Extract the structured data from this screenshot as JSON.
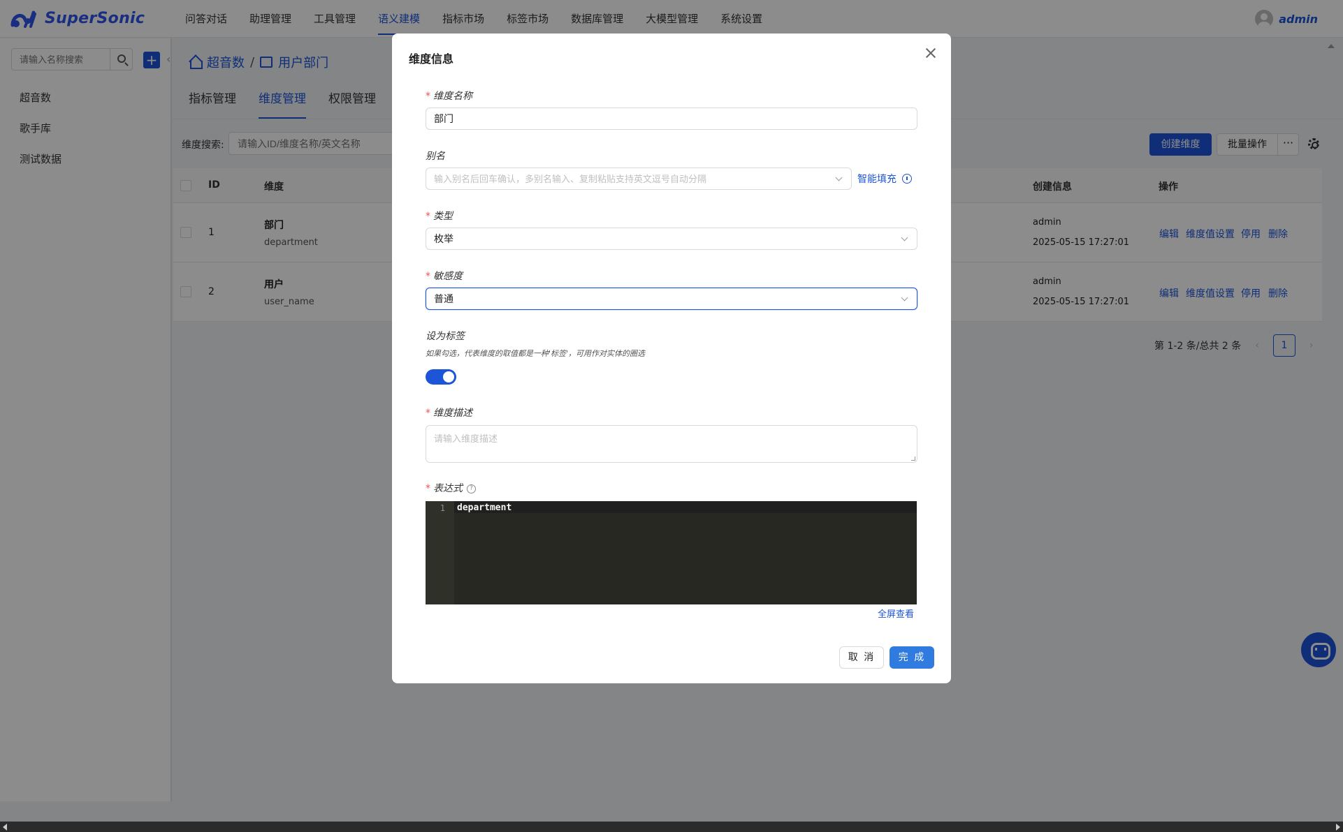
{
  "app": {
    "name": "SuperSonic",
    "user": "admin"
  },
  "nav": [
    "问答对话",
    "助理管理",
    "工具管理",
    "语义建模",
    "指标市场",
    "标签市场",
    "数据库管理",
    "大模型管理",
    "系统设置"
  ],
  "nav_active_index": 3,
  "sidebar": {
    "search_placeholder": "请输入名称搜索",
    "items": [
      "超音数",
      "歌手库",
      "测试数据"
    ]
  },
  "breadcrumb": [
    "超音数",
    "用户部门"
  ],
  "subtabs": [
    "指标管理",
    "维度管理",
    "权限管理"
  ],
  "filter": {
    "label": "维度搜索:",
    "placeholder": "请输入ID/维度名称/英文名称"
  },
  "toolbar": {
    "create": "创建维度",
    "batch": "批量操作",
    "more": "···"
  },
  "table": {
    "headers": {
      "id": "ID",
      "dimension": "维度",
      "created": "创建信息",
      "actions": "操作"
    },
    "rows": [
      {
        "id": "1",
        "name": "部门",
        "biz_name": "department",
        "creator": "admin",
        "time": "2025-05-15 17:27:01"
      },
      {
        "id": "2",
        "name": "用户",
        "biz_name": "user_name",
        "creator": "admin",
        "time": "2025-05-15 17:27:01"
      }
    ],
    "actions": [
      "编辑",
      "维度值设置",
      "停用",
      "删除"
    ]
  },
  "pager": {
    "summary": "第 1-2 条/总共 2 条",
    "current": "1"
  },
  "modal": {
    "title": "维度信息",
    "name_label": "维度名称",
    "name_value": "部门",
    "alias_label": "别名",
    "alias_placeholder": "输入别名后回车确认，多别名输入、复制粘贴支持英文逗号自动分隔",
    "smart_fill": "智能填充",
    "type_label": "类型",
    "type_value": "枚举",
    "sensitivity_label": "敏感度",
    "sensitivity_value": "普通",
    "tag_label": "设为标签",
    "tag_hint": "如果勾选，代表维度的取值都是一种'标签'，可用作对实体的圈选",
    "tag_on": true,
    "desc_label": "维度描述",
    "desc_placeholder": "请输入维度描述",
    "expr_label": "表达式",
    "expr_line_no": "1",
    "expr_code": "department",
    "fullscreen": "全屏查看",
    "cancel": "取 消",
    "ok": "完 成"
  },
  "colors": {
    "primary": "#1d55d9",
    "required": "#ff4d4f",
    "editor_bg": "#272822"
  }
}
